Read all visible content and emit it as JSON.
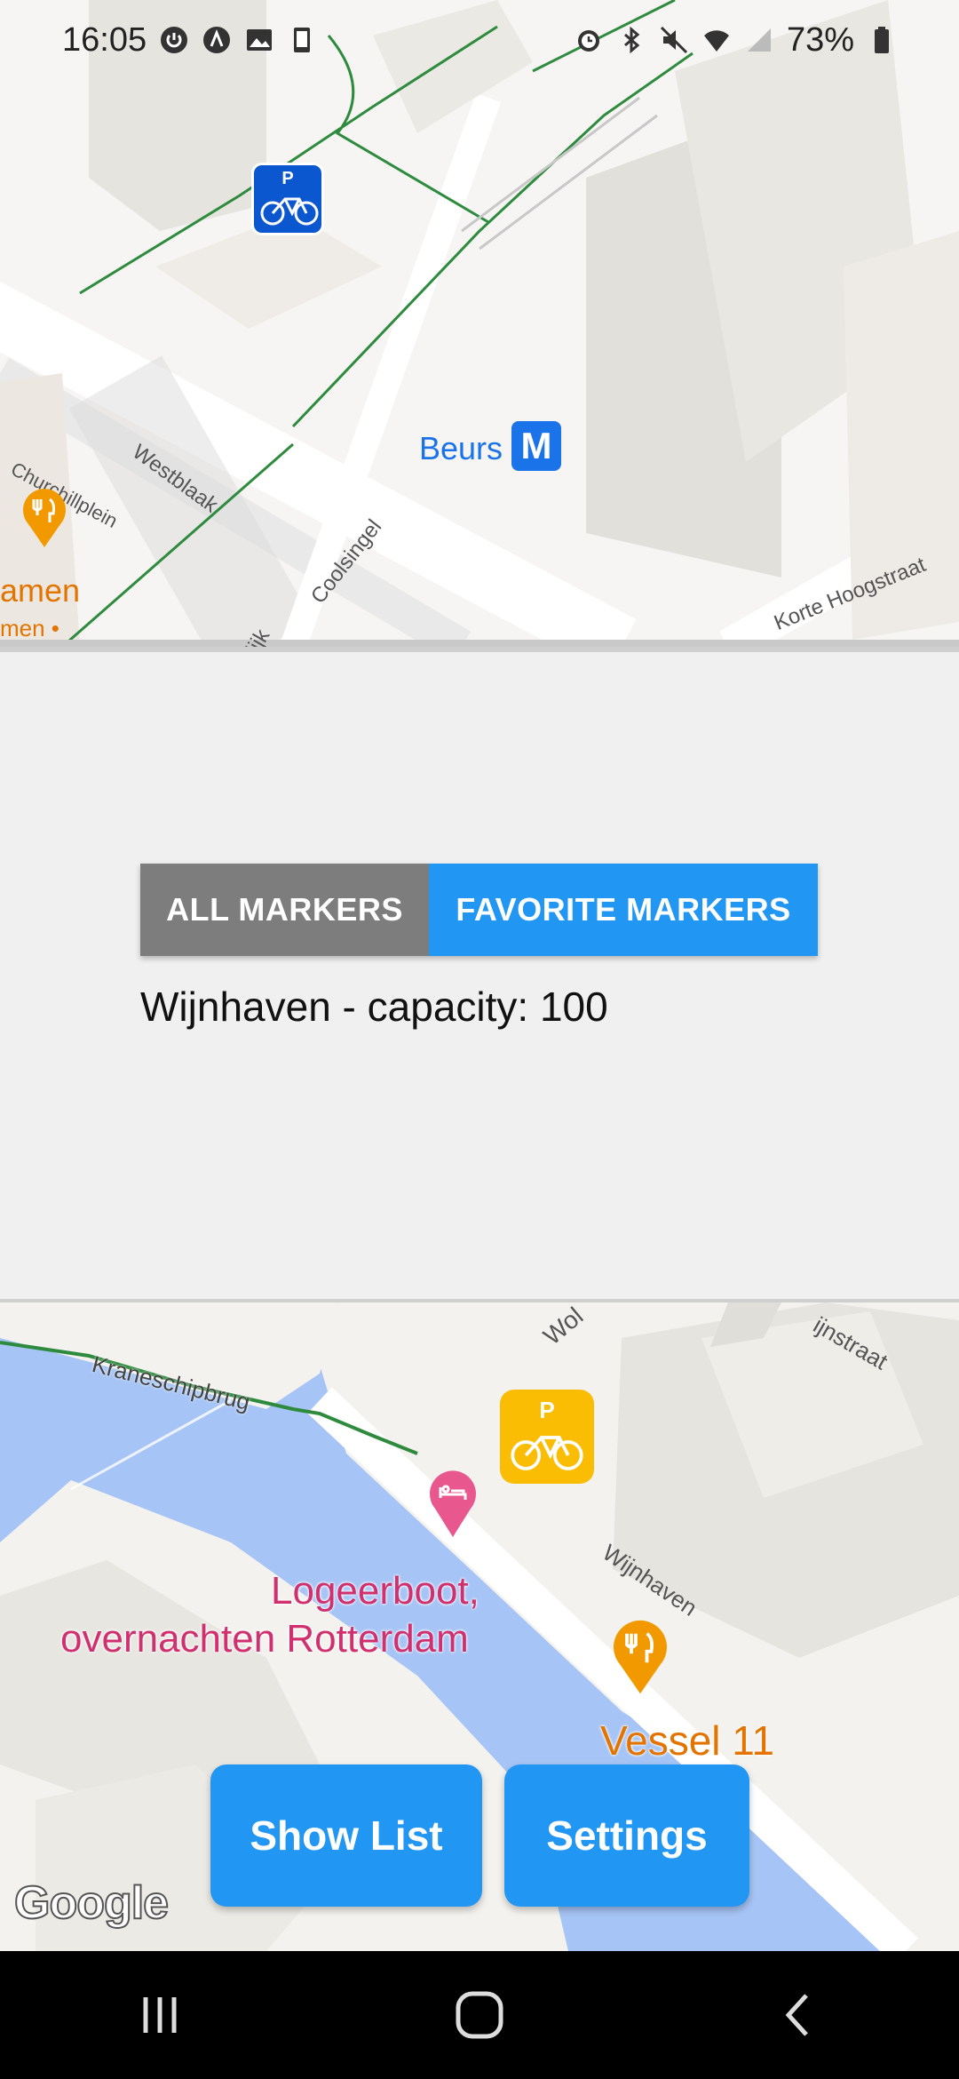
{
  "status_bar": {
    "time": "16:05",
    "battery": "73%",
    "left_icons": [
      "power-icon",
      "navigation-icon",
      "image-icon",
      "device-icon"
    ],
    "right_icons": [
      "alarm-icon",
      "bluetooth-icon",
      "mute-icon",
      "wifi-icon",
      "signal-icon",
      "battery-icon"
    ]
  },
  "map_top": {
    "labels": {
      "beurs": "Beurs",
      "metro": "M",
      "churchillplein": "Churchillplein",
      "westblaak": "Westblaak",
      "coolsingel": "Coolsingel",
      "korte_hoogstraat": "Korte Hoogstraat",
      "amen": "amen",
      "men": "men •",
      "lijk": "lijk",
      "parking": "P"
    }
  },
  "toggle": {
    "all_label": "ALL MARKERS",
    "favorite_label": "FAVORITE MARKERS"
  },
  "selected_marker_text": "Wijnhaven - capacity: 100",
  "map_bottom": {
    "labels": {
      "kraneschipbrug": "Kraneschipbrug",
      "wijnhaven": "Wijnhaven",
      "wijnstraat": "ijnstraat",
      "wol": "Wol",
      "logeerboot_1": "Logeerboot,",
      "logeerboot_2": "overnachten Rotterdam",
      "vessel": "Vessel 11",
      "parking": "P"
    },
    "google_logo": "Google"
  },
  "buttons": {
    "show_list": "Show List",
    "settings": "Settings"
  },
  "colors": {
    "primary_blue": "#2196f3",
    "toggle_inactive": "#7d7d7d",
    "water": "#a6c4f5",
    "parking_blue": "#0b57d0",
    "parking_yellow": "#fbbc04",
    "restaurant_orange": "#f29900",
    "hotel_pink": "#e8588e"
  }
}
